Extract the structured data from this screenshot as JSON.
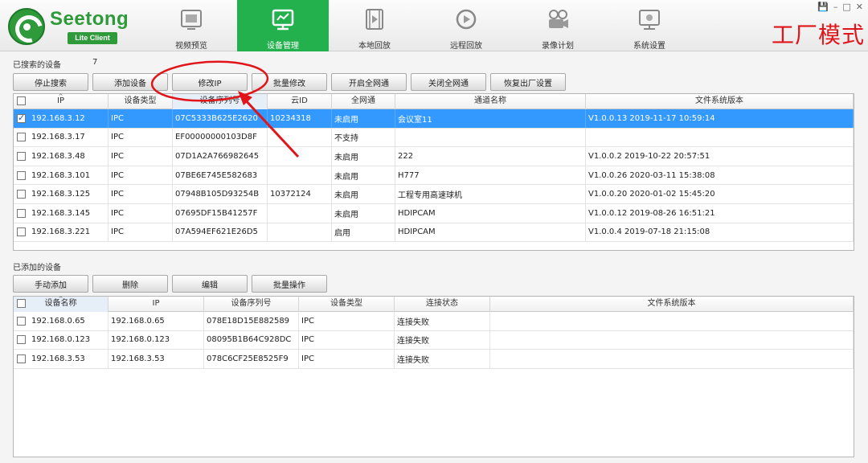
{
  "app": {
    "name": "Seetong",
    "sub": "Lite Client",
    "mode_label": "工厂模式"
  },
  "nav": [
    {
      "label": "视频预览",
      "icon": "video-preview-icon"
    },
    {
      "label": "设备管理",
      "icon": "device-manage-icon",
      "active": true
    },
    {
      "label": "本地回放",
      "icon": "local-playback-icon"
    },
    {
      "label": "远程回放",
      "icon": "remote-playback-icon"
    },
    {
      "label": "录像计划",
      "icon": "record-plan-icon"
    },
    {
      "label": "系统设置",
      "icon": "system-settings-icon"
    }
  ],
  "window_controls": [
    "💾",
    "–",
    "□",
    "✕"
  ],
  "searched": {
    "title": "已搜索的设备",
    "count": "7",
    "buttons": [
      "停止搜索",
      "添加设备",
      "修改IP",
      "批量修改",
      "开启全网通",
      "关闭全网通",
      "恢复出厂设置"
    ],
    "columns": [
      "IP",
      "设备类型",
      "设备序列号",
      "云ID",
      "全网通",
      "通道名称",
      "文件系统版本"
    ],
    "rows": [
      {
        "checked": true,
        "selected": true,
        "cells": [
          "192.168.3.12",
          "IPC",
          "07C5333B625E2620",
          "10234318",
          "未启用",
          "会议室11",
          "V1.0.0.13 2019-11-17 10:59:14"
        ]
      },
      {
        "checked": false,
        "cells": [
          "192.168.3.17",
          "IPC",
          "EF00000000103D8F",
          "",
          "不支持",
          "",
          ""
        ]
      },
      {
        "checked": false,
        "cells": [
          "192.168.3.48",
          "IPC",
          "07D1A2A766982645",
          "",
          "未启用",
          "222",
          "V1.0.0.2 2019-10-22 20:57:51"
        ]
      },
      {
        "checked": false,
        "cells": [
          "192.168.3.101",
          "IPC",
          "07BE6E745E582683",
          "",
          "未启用",
          "H777",
          "V1.0.0.26 2020-03-11 15:38:08"
        ]
      },
      {
        "checked": false,
        "cells": [
          "192.168.3.125",
          "IPC",
          "07948B105D93254B",
          "10372124",
          "未启用",
          "工程专用高速球机",
          "V1.0.0.20 2020-01-02 15:45:20"
        ]
      },
      {
        "checked": false,
        "cells": [
          "192.168.3.145",
          "IPC",
          "07695DF15B41257F",
          "",
          "未启用",
          "HDIPCAM",
          "V1.0.0.12 2019-08-26 16:51:21"
        ]
      },
      {
        "checked": false,
        "cells": [
          "192.168.3.221",
          "IPC",
          "07A594EF621E26D5",
          "",
          "启用",
          "HDIPCAM",
          "V1.0.0.4 2019-07-18 21:15:08"
        ]
      }
    ]
  },
  "added": {
    "title": "已添加的设备",
    "buttons": [
      "手动添加",
      "删除",
      "编辑",
      "批量操作"
    ],
    "columns": [
      "设备名称",
      "IP",
      "设备序列号",
      "设备类型",
      "连接状态",
      "文件系统版本"
    ],
    "rows": [
      {
        "checked": false,
        "cells": [
          "192.168.0.65",
          "192.168.0.65",
          "078E18D15E882589",
          "IPC",
          "连接失败",
          ""
        ]
      },
      {
        "checked": false,
        "cells": [
          "192.168.0.123",
          "192.168.0.123",
          "08095B1B64C928DC",
          "IPC",
          "连接失败",
          ""
        ]
      },
      {
        "checked": false,
        "cells": [
          "192.168.3.53",
          "192.168.3.53",
          "078C6CF25E8525F9",
          "IPC",
          "连接失败",
          ""
        ]
      }
    ]
  },
  "colors": {
    "brand_green": "#2e9a3a",
    "nav_active": "#23b14d",
    "selection": "#3399ff",
    "annotation_red": "#e0151a"
  }
}
